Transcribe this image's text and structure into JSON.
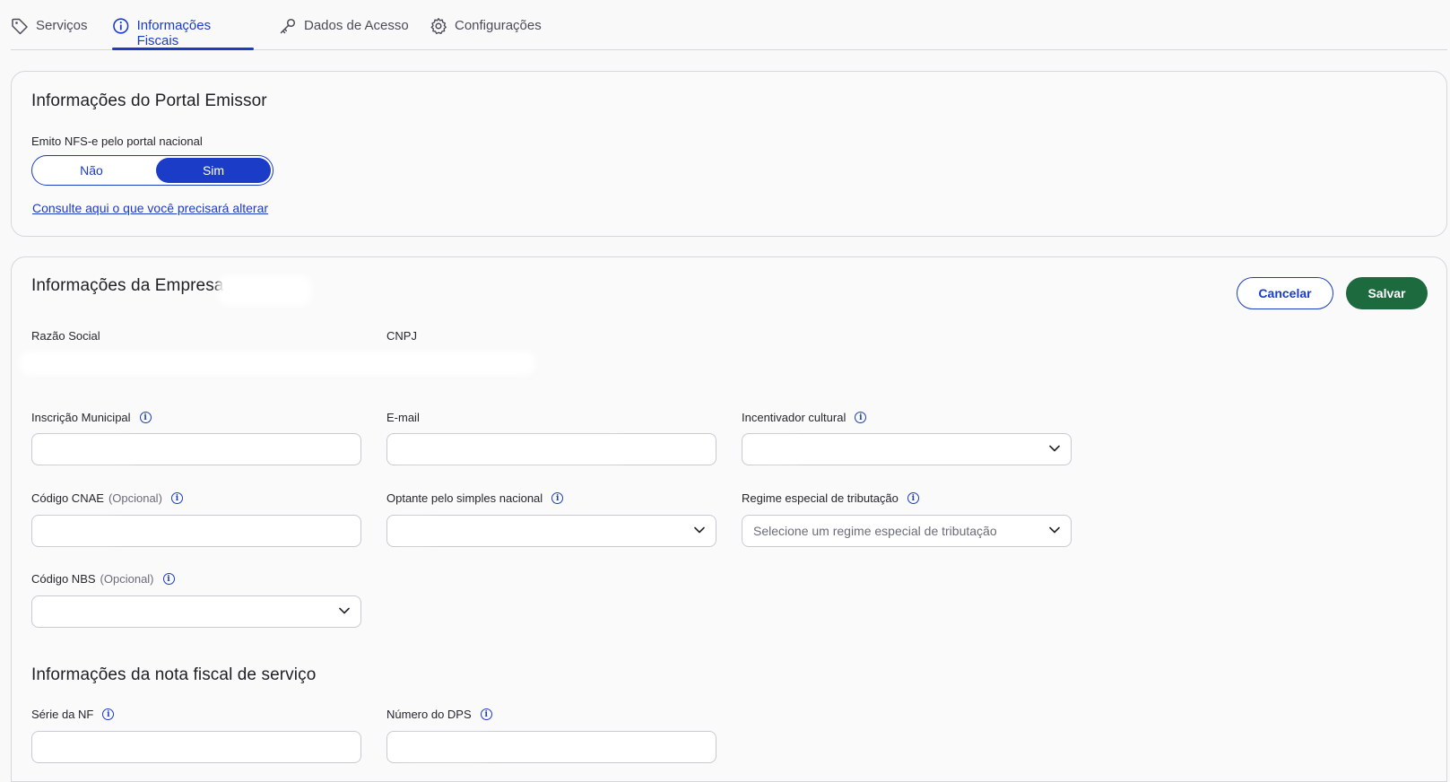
{
  "tabs": [
    {
      "label": "Serviços",
      "icon": "tag-icon",
      "active": false
    },
    {
      "label": "Informações Fiscais",
      "icon": "info-circle-icon",
      "active": true
    },
    {
      "label": "Dados de Acesso",
      "icon": "key-icon",
      "active": false
    },
    {
      "label": "Configurações",
      "icon": "gear-icon",
      "active": false
    }
  ],
  "portal": {
    "title": "Informações do Portal Emissor",
    "question": "Emito NFS-e pelo portal nacional",
    "toggle_no": "Não",
    "toggle_yes": "Sim",
    "selected": "Sim",
    "link": "Consulte aqui o que você precisará alterar"
  },
  "empresa": {
    "title": "Informações da Empresa",
    "cancel": "Cancelar",
    "save": "Salvar",
    "razao_social_label": "Razão Social",
    "cnpj_label": "CNPJ",
    "inscricao_label": "Inscrição Municipal",
    "email_label": "E-mail",
    "incentivador_label": "Incentivador cultural",
    "cnae_label": "Código CNAE",
    "optional": "(Opcional)",
    "simples_label": "Optante pelo simples nacional",
    "regime_label": "Regime especial de tributação",
    "regime_placeholder": "Selecione um regime especial de tributação",
    "nbs_label": "Código NBS"
  },
  "nota": {
    "title": "Informações da nota fiscal de serviço",
    "serie_label": "Série da NF",
    "dps_label": "Número do DPS"
  },
  "colors": {
    "accent": "#1a3cc7",
    "save": "#1d6a3e"
  }
}
